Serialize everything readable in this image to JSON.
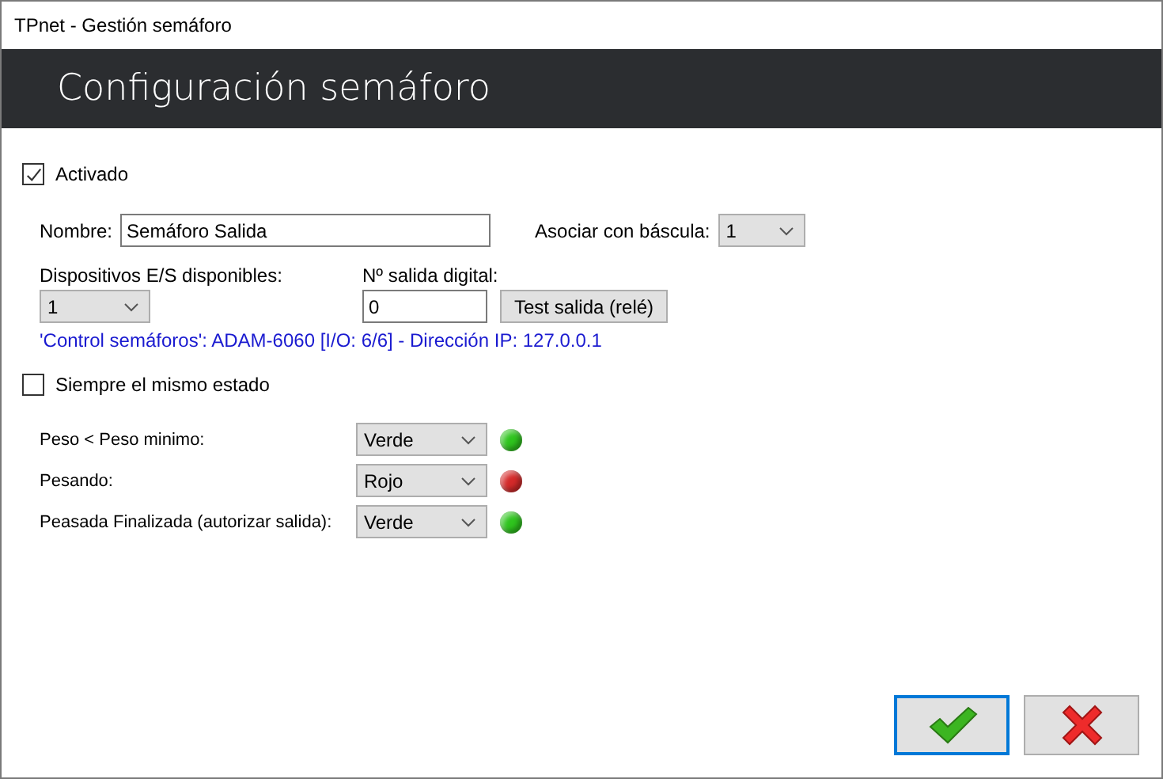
{
  "window": {
    "title": "TPnet - Gestión semáforo"
  },
  "header": {
    "title": "Configuración semáforo"
  },
  "activated": {
    "label": "Activado",
    "checked": true
  },
  "name": {
    "label": "Nombre:",
    "value": "Semáforo Salida"
  },
  "scale": {
    "label": "Asociar con báscula:",
    "value": "1"
  },
  "devices": {
    "label": "Dispositivos E/S disponibles:",
    "value": "1"
  },
  "output": {
    "label": "Nº salida digital:",
    "value": "0",
    "button": "Test salida (relé)"
  },
  "info": "'Control semáforos': ADAM-6060 [I/O: 6/6] - Dirección IP: 127.0.0.1",
  "same_state": {
    "label": "Siempre el mismo estado",
    "checked": false
  },
  "states": [
    {
      "label": "Peso < Peso minimo:",
      "value": "Verde",
      "color": "#2fc41e"
    },
    {
      "label": "Pesando:",
      "value": "Rojo",
      "color": "#d42a2a"
    },
    {
      "label": "Peasada Finalizada (autorizar salida):",
      "value": "Verde",
      "color": "#2fc41e"
    }
  ],
  "buttons": [
    {
      "kind": "ok",
      "selected": true
    },
    {
      "kind": "cancel",
      "selected": false
    }
  ]
}
